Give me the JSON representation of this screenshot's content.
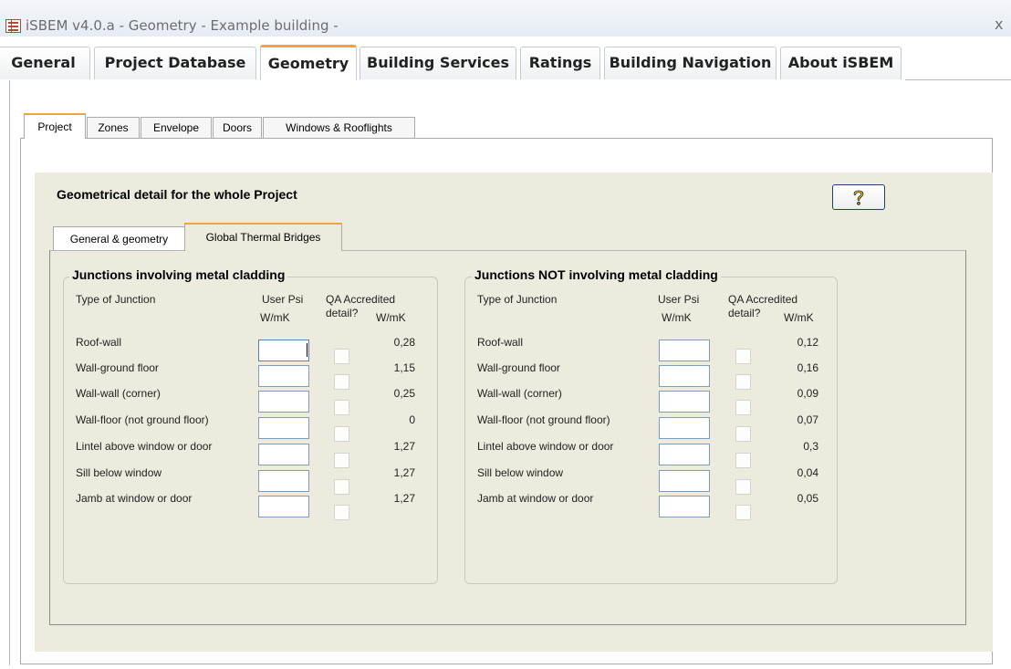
{
  "window": {
    "title": "iSBEM v4.0.a - Geometry - Example building -",
    "close": "x"
  },
  "main_tabs": [
    {
      "label": "General",
      "active": false
    },
    {
      "label": "Project Database",
      "active": false
    },
    {
      "label": "Geometry",
      "active": true
    },
    {
      "label": "Building Services",
      "active": false
    },
    {
      "label": "Ratings",
      "active": false
    },
    {
      "label": "Building Navigation",
      "active": false
    },
    {
      "label": "About iSBEM",
      "active": false
    }
  ],
  "sub_tabs": [
    {
      "label": "Project",
      "active": true
    },
    {
      "label": "Zones",
      "active": false
    },
    {
      "label": "Envelope",
      "active": false
    },
    {
      "label": "Doors",
      "active": false
    },
    {
      "label": "Windows & Rooflights",
      "active": false
    }
  ],
  "form": {
    "title": "Geometrical detail for the whole Project",
    "help_glyph": "?"
  },
  "inner_tabs": [
    {
      "label": "General & geometry",
      "active": false
    },
    {
      "label": "Global Thermal Bridges",
      "active": true
    }
  ],
  "headers": {
    "type": "Type of Junction",
    "user_psi": "User Psi",
    "user_unit": "W/mK",
    "qa_top": "QA Accredited",
    "qa_bottom": "detail?",
    "default_unit": "W/mK"
  },
  "metal": {
    "title": "Junctions involving metal cladding",
    "rows": [
      {
        "label": "Roof-wall",
        "user_psi": "",
        "qa": false,
        "value": "0,28"
      },
      {
        "label": "Wall-ground floor",
        "user_psi": "",
        "qa": false,
        "value": "1,15"
      },
      {
        "label": "Wall-wall (corner)",
        "user_psi": "",
        "qa": false,
        "value": "0,25"
      },
      {
        "label": "Wall-floor (not ground floor)",
        "user_psi": "",
        "qa": false,
        "value": "0"
      },
      {
        "label": "Lintel above window or door",
        "user_psi": "",
        "qa": false,
        "value": "1,27"
      },
      {
        "label": "Sill below window",
        "user_psi": "",
        "qa": false,
        "value": "1,27"
      },
      {
        "label": "Jamb at window or door",
        "user_psi": "",
        "qa": false,
        "value": "1,27"
      }
    ]
  },
  "non_metal": {
    "title": "Junctions NOT involving metal cladding",
    "rows": [
      {
        "label": "Roof-wall",
        "user_psi": "",
        "qa": false,
        "value": "0,12"
      },
      {
        "label": "Wall-ground floor",
        "user_psi": "",
        "qa": false,
        "value": "0,16"
      },
      {
        "label": "Wall-wall (corner)",
        "user_psi": "",
        "qa": false,
        "value": "0,09"
      },
      {
        "label": "Wall-floor (not ground floor)",
        "user_psi": "",
        "qa": false,
        "value": "0,07"
      },
      {
        "label": "Lintel above window or door",
        "user_psi": "",
        "qa": false,
        "value": "0,3"
      },
      {
        "label": "Sill below window",
        "user_psi": "",
        "qa": false,
        "value": "0,04"
      },
      {
        "label": "Jamb at window or door",
        "user_psi": "",
        "qa": false,
        "value": "0,05"
      }
    ]
  },
  "colors": {
    "accent_tab": "#f3a33a",
    "form_background": "#ecebdd",
    "input_border": "#7f9db9",
    "app_icon": "#b4483a"
  },
  "icons": {
    "app": "access-form-icon",
    "help": "help-question-icon",
    "close": "close-icon"
  }
}
